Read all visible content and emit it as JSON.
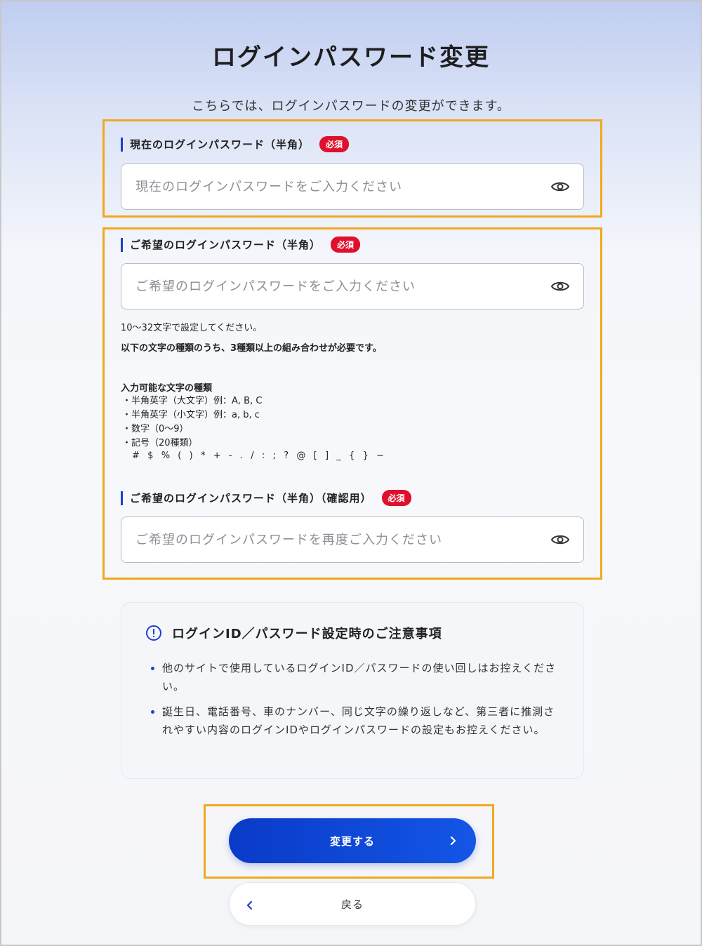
{
  "page": {
    "title": "ログインパスワード変更",
    "description": "こちらでは、ログインパスワードの変更ができます。"
  },
  "required_badge": "必須",
  "fields": {
    "current": {
      "label": "現在のログインパスワード（半角）",
      "placeholder": "現在のログインパスワードをご入力ください"
    },
    "new": {
      "label": "ご希望のログインパスワード（半角）",
      "placeholder": "ご希望のログインパスワードをご入力ください"
    },
    "confirm": {
      "label": "ご希望のログインパスワード（半角）（確認用）",
      "placeholder": "ご希望のログインパスワードを再度ご入力ください"
    }
  },
  "rules": {
    "length": "10〜32文字で設定してください。",
    "combination": "以下の文字の種類のうち、3種類以上の組み合わせが必要です。",
    "types_title": "入力可能な文字の種類",
    "types": [
      "・半角英字（大文字）例：A, B, C",
      "・半角英字（小文字）例：a, b, c",
      "・数字（0〜9）",
      "・記号（20種類）"
    ],
    "symbols": "#  $  %  (  )  *  +  -  .  /  :  ;  ?  @  [  ]  _  {  }  ~"
  },
  "caution": {
    "title": "ログインID／パスワード設定時のご注意事項",
    "items": [
      "他のサイトで使用しているログインID／パスワードの使い回しはお控えください。",
      "誕生日、電話番号、車のナンバー、同じ文字の繰り返しなど、第三者に推測されやすい内容のログインIDやログインパスワードの設定もお控えください。"
    ]
  },
  "buttons": {
    "submit": "変更する",
    "back": "戻る"
  },
  "colors": {
    "accent": "#1e40c8",
    "required": "#e0102c",
    "highlight": "#f1a820"
  },
  "icons": {
    "eye": "eye-icon",
    "info": "info-icon",
    "chevron_right": "chevron-right-icon",
    "chevron_left": "chevron-left-icon"
  }
}
